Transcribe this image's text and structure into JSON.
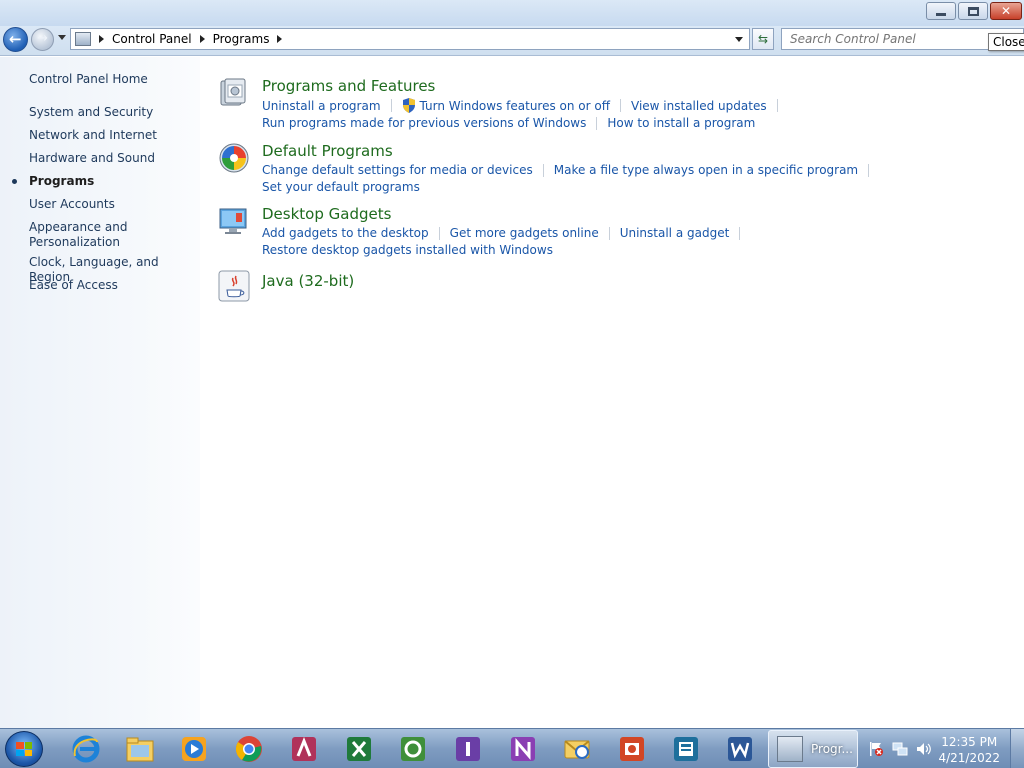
{
  "titlebar": {
    "buttons": [
      "minimize",
      "maximize",
      "close"
    ]
  },
  "address_bar": {
    "breadcrumbs": [
      "Control Panel",
      "Programs"
    ],
    "search_placeholder": "Search Control Panel"
  },
  "tooltip": {
    "text": "Close"
  },
  "sidebar": {
    "items": [
      {
        "label": "Control Panel Home",
        "active": false
      },
      {
        "label": "System and Security",
        "active": false
      },
      {
        "label": "Network and Internet",
        "active": false
      },
      {
        "label": "Hardware and Sound",
        "active": false
      },
      {
        "label": "Programs",
        "active": true
      },
      {
        "label": "User Accounts",
        "active": false
      },
      {
        "label": "Appearance and Personalization",
        "active": false
      },
      {
        "label": "Clock, Language, and Region",
        "active": false
      },
      {
        "label": "Ease of Access",
        "active": false
      }
    ]
  },
  "categories": [
    {
      "title": "Programs and Features",
      "icon": "programs-features-icon",
      "rows": [
        [
          "Uninstall a program",
          "Turn Windows features on or off",
          "View installed updates"
        ],
        [
          "Run programs made for previous versions of Windows",
          "How to install a program"
        ]
      ]
    },
    {
      "title": "Default Programs",
      "icon": "default-programs-icon",
      "rows": [
        [
          "Change default settings for media or devices",
          "Make a file type always open in a specific program"
        ],
        [
          "Set your default programs"
        ]
      ]
    },
    {
      "title": "Desktop Gadgets",
      "icon": "desktop-gadgets-icon",
      "rows": [
        [
          "Add gadgets to the desktop",
          "Get more gadgets online",
          "Uninstall a gadget"
        ],
        [
          "Restore desktop gadgets installed with Windows"
        ]
      ]
    },
    {
      "title": "Java (32-bit)",
      "icon": "java-icon",
      "rows": []
    }
  ],
  "taskbar": {
    "pinned": [
      "internet-explorer-icon",
      "windows-explorer-icon",
      "media-player-icon",
      "chrome-icon",
      "access-icon",
      "excel-icon",
      "sharepoint-workspace-icon",
      "infopath-icon",
      "onenote-icon",
      "outlook-icon",
      "powerpoint-icon",
      "publisher-icon",
      "word-icon"
    ],
    "active_task_label": "Progr...",
    "clock_time": "12:35 PM",
    "clock_date": "4/21/2022"
  },
  "colors": {
    "link": "#1a56a8",
    "category_title": "#1e6b1e",
    "sidebar_link": "#1e395b"
  }
}
